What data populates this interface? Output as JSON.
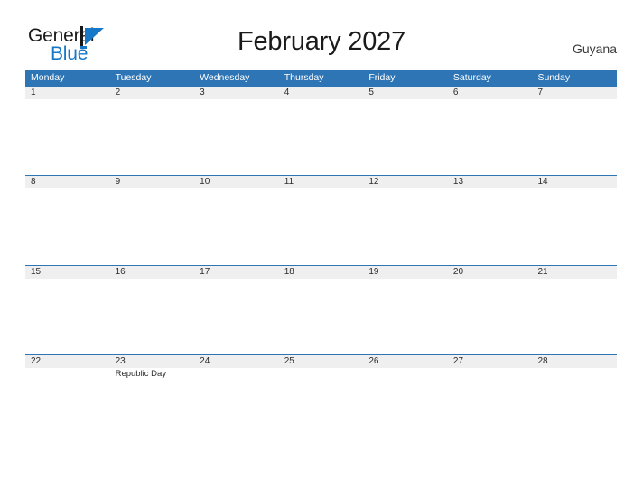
{
  "brand": {
    "name_part1": "General",
    "name_part2": "Blue",
    "mark_icon": "triangle-flag-icon",
    "color_dark": "#1a1a1a",
    "color_blue": "#1878c8"
  },
  "header": {
    "title": "February 2027",
    "country": "Guyana"
  },
  "theme": {
    "header_blue": "#2e75b6",
    "row_band_gray": "#efefef",
    "text_dark": "#2b2b2b",
    "page_background": "#ffffff"
  },
  "calendar": {
    "weekdays": [
      "Monday",
      "Tuesday",
      "Wednesday",
      "Thursday",
      "Friday",
      "Saturday",
      "Sunday"
    ],
    "weeks": [
      [
        {
          "day": "1",
          "event": ""
        },
        {
          "day": "2",
          "event": ""
        },
        {
          "day": "3",
          "event": ""
        },
        {
          "day": "4",
          "event": ""
        },
        {
          "day": "5",
          "event": ""
        },
        {
          "day": "6",
          "event": ""
        },
        {
          "day": "7",
          "event": ""
        }
      ],
      [
        {
          "day": "8",
          "event": ""
        },
        {
          "day": "9",
          "event": ""
        },
        {
          "day": "10",
          "event": ""
        },
        {
          "day": "11",
          "event": ""
        },
        {
          "day": "12",
          "event": ""
        },
        {
          "day": "13",
          "event": ""
        },
        {
          "day": "14",
          "event": ""
        }
      ],
      [
        {
          "day": "15",
          "event": ""
        },
        {
          "day": "16",
          "event": ""
        },
        {
          "day": "17",
          "event": ""
        },
        {
          "day": "18",
          "event": ""
        },
        {
          "day": "19",
          "event": ""
        },
        {
          "day": "20",
          "event": ""
        },
        {
          "day": "21",
          "event": ""
        }
      ],
      [
        {
          "day": "22",
          "event": ""
        },
        {
          "day": "23",
          "event": "Republic Day"
        },
        {
          "day": "24",
          "event": ""
        },
        {
          "day": "25",
          "event": ""
        },
        {
          "day": "26",
          "event": ""
        },
        {
          "day": "27",
          "event": ""
        },
        {
          "day": "28",
          "event": ""
        }
      ]
    ]
  }
}
